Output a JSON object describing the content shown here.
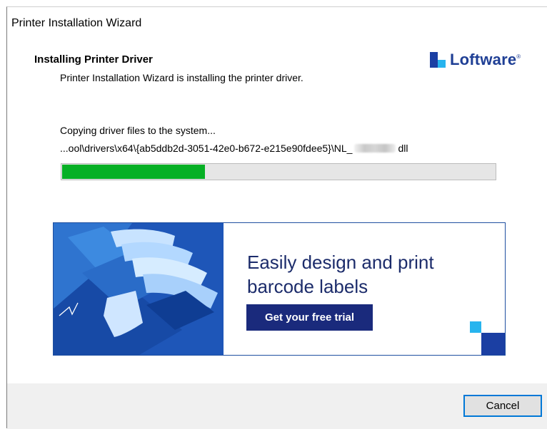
{
  "window": {
    "title": "Printer Installation Wizard"
  },
  "header": {
    "heading": "Installing Printer Driver",
    "subheading": "Printer Installation Wizard is installing the printer driver.",
    "logo_text": "Loftware",
    "logo_mark": "®"
  },
  "progress": {
    "status": "Copying driver files to the system...",
    "path_prefix": "...ool\\drivers\\x64\\{ab5ddb2d-3051-42e0-b672-e215e90fdee5}\\NL_",
    "path_suffix": "dll",
    "fraction": 0.33
  },
  "banner": {
    "headline": "Easily design and print barcode labels",
    "cta_label": "Get your free trial"
  },
  "footer": {
    "cancel_label": "Cancel"
  },
  "colors": {
    "progress_fill": "#06b025",
    "brand_navy": "#1a2a7c",
    "brand_blue": "#1b3fa3",
    "accent_cyan": "#27b4ee"
  }
}
